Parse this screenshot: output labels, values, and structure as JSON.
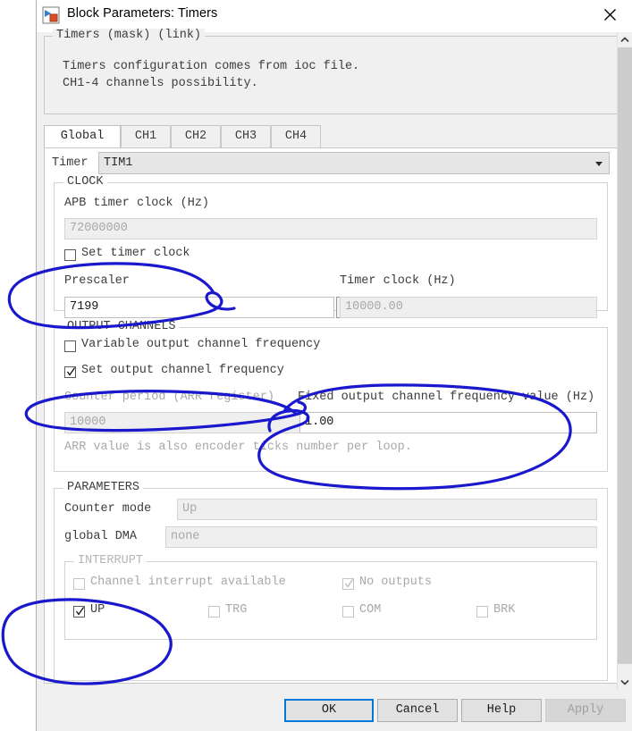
{
  "window": {
    "title": "Block Parameters: Timers",
    "icon": "simulink-block-icon",
    "close_icon": "close-icon"
  },
  "mask": {
    "legend": "Timers (mask) (link)",
    "description": "Timers configuration comes from ioc file.\nCH1-4 channels possibility."
  },
  "tabs": [
    {
      "label": "Global",
      "active": true
    },
    {
      "label": "CH1",
      "active": false
    },
    {
      "label": "CH2",
      "active": false
    },
    {
      "label": "CH3",
      "active": false
    },
    {
      "label": "CH4",
      "active": false
    }
  ],
  "timer": {
    "label": "Timer",
    "value": "TIM1",
    "dropdown_icon": "chevron-down-icon"
  },
  "clock": {
    "legend": "CLOCK",
    "apb_label": "APB timer clock (Hz)",
    "apb_value": "72000000",
    "set_timer_clock_label": "Set timer clock",
    "set_timer_clock_checked": false,
    "prescaler_label": "Prescaler",
    "prescaler_value": "7199",
    "spinner_icon": "spinner-dots-icon",
    "timer_clock_label": "Timer clock (Hz)",
    "timer_clock_value": "10000.00"
  },
  "output_channels": {
    "legend": "OUTPUT CHANNELS",
    "variable_freq_label": "Variable output channel frequency",
    "variable_freq_checked": false,
    "set_freq_label": "Set output channel frequency",
    "set_freq_checked": true,
    "arr_label": "Counter period (ARR register)",
    "arr_value": "10000",
    "fixed_freq_label": "Fixed output channel frequency value (Hz)",
    "fixed_freq_value": "1.00",
    "hint": "ARR value is also encoder ticks number per loop."
  },
  "parameters": {
    "legend": "PARAMETERS",
    "counter_mode_label": "Counter mode",
    "counter_mode_value": "Up",
    "global_dma_label": "global DMA",
    "global_dma_value": "none"
  },
  "interrupt": {
    "legend": "INTERRUPT",
    "items": [
      {
        "label": "Channel interrupt available",
        "checked": false,
        "disabled": true
      },
      {
        "label": "No outputs",
        "checked": true,
        "disabled": true
      },
      {
        "label": "UP",
        "checked": true,
        "disabled": false
      },
      {
        "label": "TRG",
        "checked": false,
        "disabled": true
      },
      {
        "label": "COM",
        "checked": false,
        "disabled": true
      },
      {
        "label": "BRK",
        "checked": false,
        "disabled": true
      }
    ]
  },
  "footer": {
    "ok": "OK",
    "cancel": "Cancel",
    "help": "Help",
    "apply": "Apply"
  },
  "scrollbar": {
    "up_icon": "chevron-up-icon",
    "down_icon": "chevron-down-icon"
  },
  "annotations": {
    "color": "#1a18cc",
    "shapes": [
      "ellipse-around-prescaler",
      "ellipse-around-set-output-channel-frequency",
      "ellipse-around-fixed-output-frequency",
      "ellipse-around-up-interrupt"
    ]
  }
}
